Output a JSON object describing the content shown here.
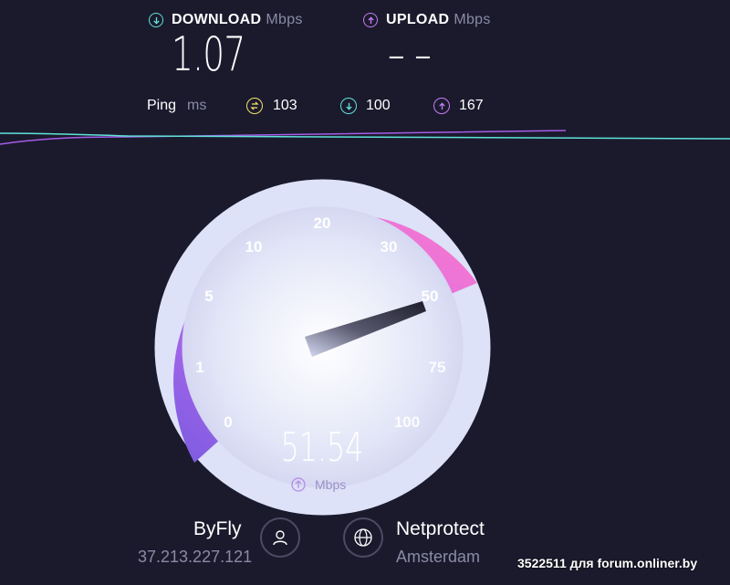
{
  "download": {
    "label": "DOWNLOAD",
    "unit": "Mbps",
    "value": "1.07",
    "icon": "download-arrow-icon",
    "color": "#5ee3d8"
  },
  "upload": {
    "label": "UPLOAD",
    "unit": "Mbps",
    "value": "– –",
    "icon": "upload-arrow-icon",
    "color": "#c47cf5"
  },
  "ping": {
    "label": "Ping",
    "unit": "ms",
    "idle": {
      "value": "103",
      "icon": "ping-idle-icon",
      "color": "#f2e26b"
    },
    "down": {
      "value": "100",
      "icon": "ping-down-icon",
      "color": "#5ee3d8"
    },
    "up": {
      "value": "167",
      "icon": "ping-up-icon",
      "color": "#c47cf5"
    }
  },
  "gauge": {
    "scale": [
      "0",
      "1",
      "5",
      "10",
      "20",
      "30",
      "50",
      "75",
      "100"
    ],
    "value": "51.54",
    "unit": "Mbps",
    "progress_scale_value": 50,
    "colors": {
      "start": "#7a5be0",
      "mid": "#c86ef2",
      "end": "#ff78c8",
      "face": "#dde2f8"
    }
  },
  "isp": {
    "name": "ByFly",
    "ip": "37.213.227.121",
    "icon": "user-icon"
  },
  "server": {
    "name": "Netprotect",
    "location": "Amsterdam",
    "icon": "globe-icon"
  },
  "watermark": "3522511 для forum.onliner.by"
}
